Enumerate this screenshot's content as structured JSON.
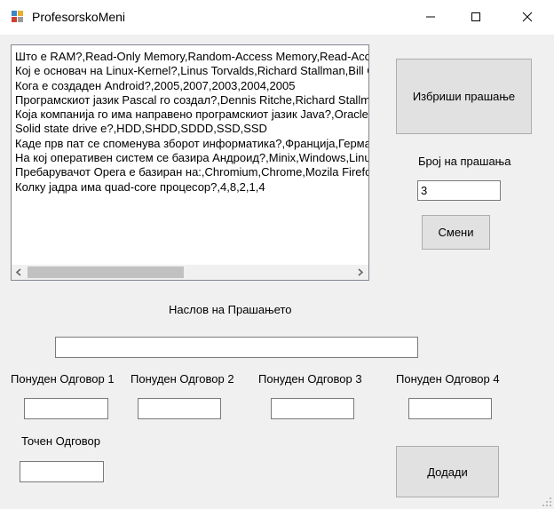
{
  "window": {
    "title": "ProfesorskoMeni"
  },
  "questions_list": {
    "items": [
      "Што е RAM?,Read-Only Memory,Random-Access Memory,Read-Access Memory,Random-Only Memory,Random-Access Memory",
      "Кој е основач на Linux-Kernel?,Linus Torvalds,Richard Stallman,Bill Gates,Steve Jobs,Linus Torvalds",
      "Кога е создаден Android?,2005,2007,2003,2004,2005",
      "Програмскиот јазик Pascal го создал?,Dennis Ritche,Richard Stallman,Niklaus Wirth,Bjarne Stroustrup,Niklaus Wirth",
      "Која компанија го има направено програмскиот јазик Java?,Oracle,Microsoft,Google,Sun Microsystems,Sun Microsystems",
      "Solid state drive е?,HDD,SHDD,SDDD,SSD,SSD",
      "Каде прв пат се споменува зборот информатика?,Франција,Германија,Англија,САД,Германија",
      "На кој оперативен систем се базира Андроид?,Minix,Windows,Linux,Unix,Linux",
      "Пребарувачот Opera е базиран на:,Chromium,Chrome,Mozila Firefox,Safari,Chromium",
      "Колку јадра има quad-core процесор?,4,8,2,1,4"
    ]
  },
  "delete_button": {
    "label": "Избриши прашање"
  },
  "question_number": {
    "label": "Број на прашања",
    "value": "3"
  },
  "change_button": {
    "label": "Смени"
  },
  "question_title": {
    "label": "Наслов на Прашањето",
    "value": ""
  },
  "answers": {
    "answer1_label": "Понуден Одговор 1",
    "answer2_label": "Понуден Одговор 2",
    "answer3_label": "Понуден Одговор 3",
    "answer4_label": "Понуден Одговор 4",
    "answer1_value": "",
    "answer2_value": "",
    "answer3_value": "",
    "answer4_value": ""
  },
  "correct_answer": {
    "label": "Точен Одговор",
    "value": ""
  },
  "add_button": {
    "label": "Додади"
  }
}
